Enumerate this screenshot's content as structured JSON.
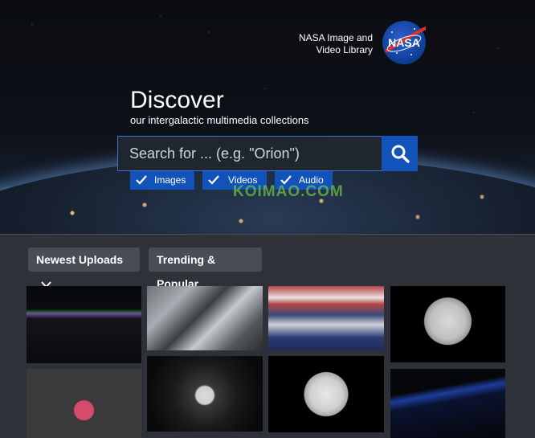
{
  "header": {
    "brand_line1": "NASA Image and",
    "brand_line2": "Video Library",
    "logo_text": "NASA"
  },
  "hero": {
    "title": "Discover",
    "subtitle": "our intergalactic multimedia collections"
  },
  "search": {
    "placeholder": "Search for ... (e.g. \"Orion\")",
    "value": ""
  },
  "filters": [
    {
      "label": "Images",
      "checked": true
    },
    {
      "label": "Videos",
      "checked": true
    },
    {
      "label": "Audio",
      "checked": true
    }
  ],
  "watermark": "KOIMAO.COM",
  "sort": {
    "newest_label": "Newest Uploads",
    "trending_label": "Trending & Popular"
  },
  "colors": {
    "accent": "#1153b8",
    "background": "#2e3138",
    "pill": "#474c55"
  }
}
